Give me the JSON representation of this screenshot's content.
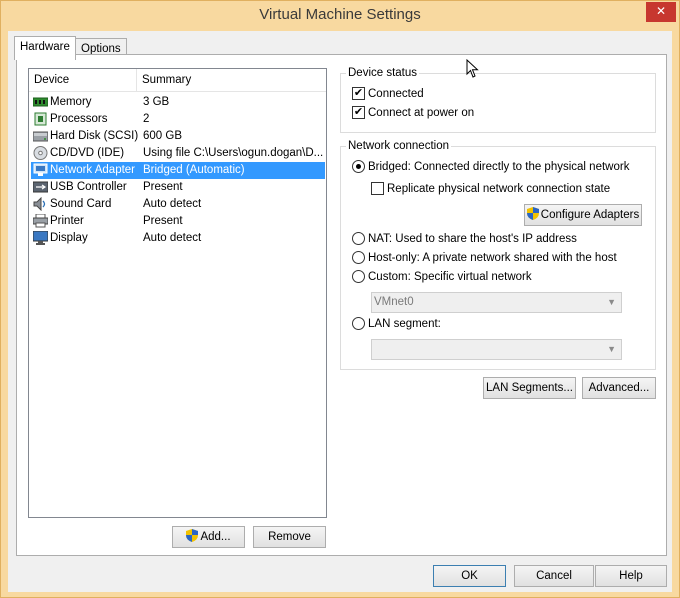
{
  "window": {
    "title": "Virtual Machine Settings",
    "close_glyph": "✕"
  },
  "tabs": [
    {
      "label": "Hardware",
      "active": true
    },
    {
      "label": "Options",
      "active": false
    }
  ],
  "device_list": {
    "columns": [
      "Device",
      "Summary"
    ],
    "rows": [
      {
        "device": "Memory",
        "summary": "3 GB",
        "icon": "memory-icon",
        "selected": false
      },
      {
        "device": "Processors",
        "summary": "2",
        "icon": "processor-icon",
        "selected": false
      },
      {
        "device": "Hard Disk (SCSI)",
        "summary": "600 GB",
        "icon": "hard-disk-icon",
        "selected": false
      },
      {
        "device": "CD/DVD (IDE)",
        "summary": "Using file C:\\Users\\ogun.dogan\\D...",
        "icon": "cd-dvd-icon",
        "selected": false
      },
      {
        "device": "Network Adapter",
        "summary": "Bridged (Automatic)",
        "icon": "network-adapter-icon",
        "selected": true
      },
      {
        "device": "USB Controller",
        "summary": "Present",
        "icon": "usb-icon",
        "selected": false
      },
      {
        "device": "Sound Card",
        "summary": "Auto detect",
        "icon": "sound-card-icon",
        "selected": false
      },
      {
        "device": "Printer",
        "summary": "Present",
        "icon": "printer-icon",
        "selected": false
      },
      {
        "device": "Display",
        "summary": "Auto detect",
        "icon": "display-icon",
        "selected": false
      }
    ]
  },
  "list_buttons": {
    "add": "Add...",
    "remove": "Remove"
  },
  "device_status": {
    "title": "Device status",
    "connected": {
      "label": "Connected",
      "checked": true
    },
    "connect_at_power_on": {
      "label": "Connect at power on",
      "checked": true
    }
  },
  "network_connection": {
    "title": "Network connection",
    "bridged": {
      "label": "Bridged: Connected directly to the physical network",
      "selected": true
    },
    "replicate": {
      "label": "Replicate physical network connection state",
      "checked": false
    },
    "configure_adapters": "Configure Adapters",
    "nat": {
      "label": "NAT: Used to share the host's IP address",
      "selected": false
    },
    "host_only": {
      "label": "Host-only: A private network shared with the host",
      "selected": false
    },
    "custom": {
      "label": "Custom: Specific virtual network",
      "selected": false
    },
    "custom_select": {
      "value": "VMnet0"
    },
    "lan_segment": {
      "label": "LAN segment:",
      "selected": false
    },
    "lan_segment_select": {
      "value": ""
    }
  },
  "right_buttons": {
    "lan_segments": "LAN Segments...",
    "advanced": "Advanced..."
  },
  "dialog_buttons": {
    "ok": "OK",
    "cancel": "Cancel",
    "help": "Help"
  },
  "colors": {
    "selection": "#3399ff",
    "title_bar": "#f8d9a0",
    "close": "#c7372f"
  }
}
